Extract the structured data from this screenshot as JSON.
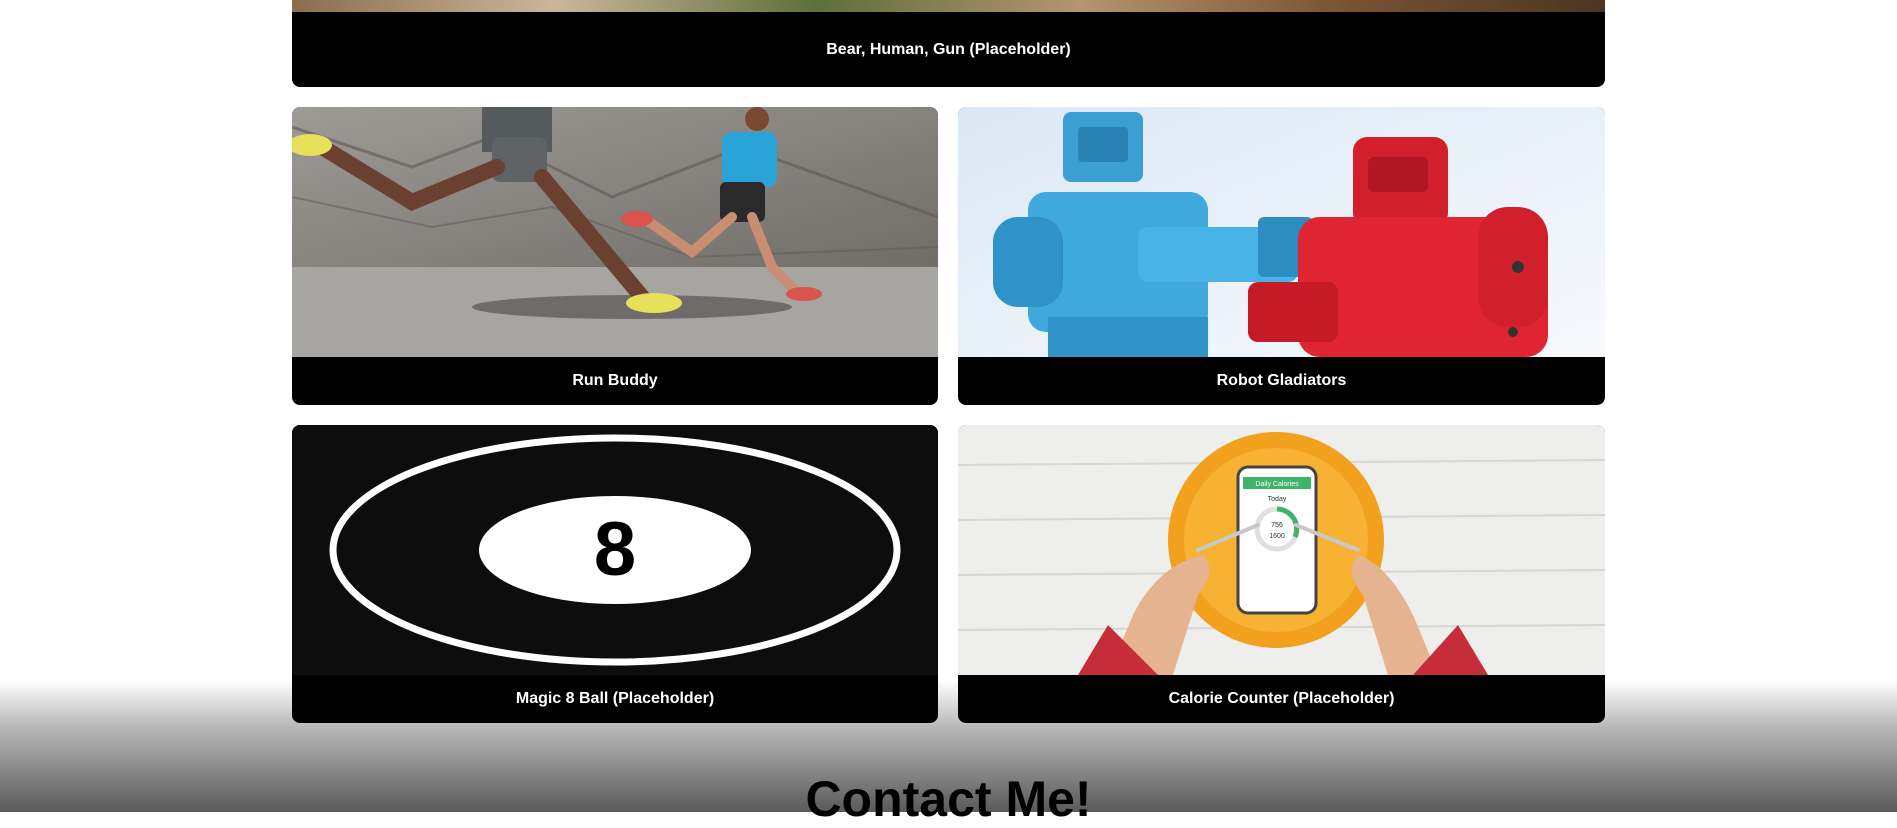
{
  "projects": [
    {
      "id": "top",
      "label": "Bear, Human, Gun (Placeholder)"
    },
    {
      "id": "run",
      "label": "Run Buddy"
    },
    {
      "id": "robot",
      "label": "Robot Gladiators"
    },
    {
      "id": "8ball",
      "label": "Magic 8 Ball (Placeholder)"
    },
    {
      "id": "cal",
      "label": "Calorie Counter (Placeholder)"
    }
  ],
  "contact": {
    "title": "Contact Me!"
  },
  "images": {
    "run": "runners-photo",
    "robot": "robot-toys-photo",
    "8ball": "magic-8-ball-graphic",
    "8ball_digit": "8",
    "cal": "phone-on-plate-photo",
    "cal_phone_title": "Daily Calories",
    "cal_phone_today": "Today",
    "cal_phone_num1": "756",
    "cal_phone_num2": "1600"
  }
}
